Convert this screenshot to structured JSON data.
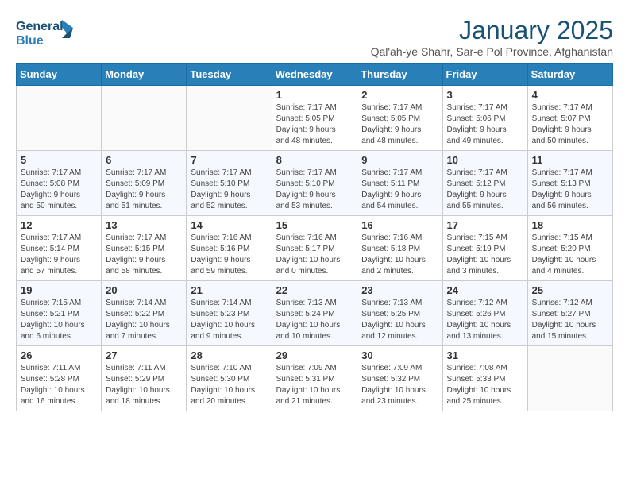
{
  "header": {
    "logo_line1": "General",
    "logo_line2": "Blue",
    "title": "January 2025",
    "subtitle": "Qal'ah-ye Shahr, Sar-e Pol Province, Afghanistan"
  },
  "days_of_week": [
    "Sunday",
    "Monday",
    "Tuesday",
    "Wednesday",
    "Thursday",
    "Friday",
    "Saturday"
  ],
  "weeks": [
    [
      {
        "day": "",
        "info": ""
      },
      {
        "day": "",
        "info": ""
      },
      {
        "day": "",
        "info": ""
      },
      {
        "day": "1",
        "info": "Sunrise: 7:17 AM\nSunset: 5:05 PM\nDaylight: 9 hours\nand 48 minutes."
      },
      {
        "day": "2",
        "info": "Sunrise: 7:17 AM\nSunset: 5:05 PM\nDaylight: 9 hours\nand 48 minutes."
      },
      {
        "day": "3",
        "info": "Sunrise: 7:17 AM\nSunset: 5:06 PM\nDaylight: 9 hours\nand 49 minutes."
      },
      {
        "day": "4",
        "info": "Sunrise: 7:17 AM\nSunset: 5:07 PM\nDaylight: 9 hours\nand 50 minutes."
      }
    ],
    [
      {
        "day": "5",
        "info": "Sunrise: 7:17 AM\nSunset: 5:08 PM\nDaylight: 9 hours\nand 50 minutes."
      },
      {
        "day": "6",
        "info": "Sunrise: 7:17 AM\nSunset: 5:09 PM\nDaylight: 9 hours\nand 51 minutes."
      },
      {
        "day": "7",
        "info": "Sunrise: 7:17 AM\nSunset: 5:10 PM\nDaylight: 9 hours\nand 52 minutes."
      },
      {
        "day": "8",
        "info": "Sunrise: 7:17 AM\nSunset: 5:10 PM\nDaylight: 9 hours\nand 53 minutes."
      },
      {
        "day": "9",
        "info": "Sunrise: 7:17 AM\nSunset: 5:11 PM\nDaylight: 9 hours\nand 54 minutes."
      },
      {
        "day": "10",
        "info": "Sunrise: 7:17 AM\nSunset: 5:12 PM\nDaylight: 9 hours\nand 55 minutes."
      },
      {
        "day": "11",
        "info": "Sunrise: 7:17 AM\nSunset: 5:13 PM\nDaylight: 9 hours\nand 56 minutes."
      }
    ],
    [
      {
        "day": "12",
        "info": "Sunrise: 7:17 AM\nSunset: 5:14 PM\nDaylight: 9 hours\nand 57 minutes."
      },
      {
        "day": "13",
        "info": "Sunrise: 7:17 AM\nSunset: 5:15 PM\nDaylight: 9 hours\nand 58 minutes."
      },
      {
        "day": "14",
        "info": "Sunrise: 7:16 AM\nSunset: 5:16 PM\nDaylight: 9 hours\nand 59 minutes."
      },
      {
        "day": "15",
        "info": "Sunrise: 7:16 AM\nSunset: 5:17 PM\nDaylight: 10 hours\nand 0 minutes."
      },
      {
        "day": "16",
        "info": "Sunrise: 7:16 AM\nSunset: 5:18 PM\nDaylight: 10 hours\nand 2 minutes."
      },
      {
        "day": "17",
        "info": "Sunrise: 7:15 AM\nSunset: 5:19 PM\nDaylight: 10 hours\nand 3 minutes."
      },
      {
        "day": "18",
        "info": "Sunrise: 7:15 AM\nSunset: 5:20 PM\nDaylight: 10 hours\nand 4 minutes."
      }
    ],
    [
      {
        "day": "19",
        "info": "Sunrise: 7:15 AM\nSunset: 5:21 PM\nDaylight: 10 hours\nand 6 minutes."
      },
      {
        "day": "20",
        "info": "Sunrise: 7:14 AM\nSunset: 5:22 PM\nDaylight: 10 hours\nand 7 minutes."
      },
      {
        "day": "21",
        "info": "Sunrise: 7:14 AM\nSunset: 5:23 PM\nDaylight: 10 hours\nand 9 minutes."
      },
      {
        "day": "22",
        "info": "Sunrise: 7:13 AM\nSunset: 5:24 PM\nDaylight: 10 hours\nand 10 minutes."
      },
      {
        "day": "23",
        "info": "Sunrise: 7:13 AM\nSunset: 5:25 PM\nDaylight: 10 hours\nand 12 minutes."
      },
      {
        "day": "24",
        "info": "Sunrise: 7:12 AM\nSunset: 5:26 PM\nDaylight: 10 hours\nand 13 minutes."
      },
      {
        "day": "25",
        "info": "Sunrise: 7:12 AM\nSunset: 5:27 PM\nDaylight: 10 hours\nand 15 minutes."
      }
    ],
    [
      {
        "day": "26",
        "info": "Sunrise: 7:11 AM\nSunset: 5:28 PM\nDaylight: 10 hours\nand 16 minutes."
      },
      {
        "day": "27",
        "info": "Sunrise: 7:11 AM\nSunset: 5:29 PM\nDaylight: 10 hours\nand 18 minutes."
      },
      {
        "day": "28",
        "info": "Sunrise: 7:10 AM\nSunset: 5:30 PM\nDaylight: 10 hours\nand 20 minutes."
      },
      {
        "day": "29",
        "info": "Sunrise: 7:09 AM\nSunset: 5:31 PM\nDaylight: 10 hours\nand 21 minutes."
      },
      {
        "day": "30",
        "info": "Sunrise: 7:09 AM\nSunset: 5:32 PM\nDaylight: 10 hours\nand 23 minutes."
      },
      {
        "day": "31",
        "info": "Sunrise: 7:08 AM\nSunset: 5:33 PM\nDaylight: 10 hours\nand 25 minutes."
      },
      {
        "day": "",
        "info": ""
      }
    ]
  ]
}
